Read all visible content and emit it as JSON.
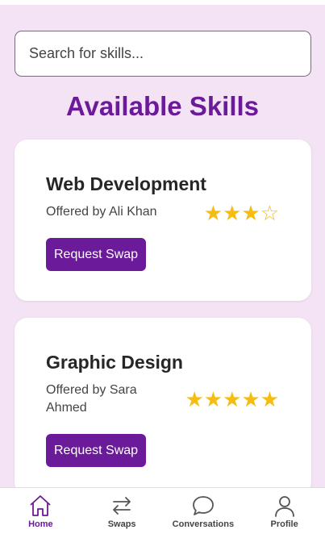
{
  "search": {
    "placeholder": "Search for skills..."
  },
  "page": {
    "title": "Available Skills"
  },
  "skills": [
    {
      "title": "Web Development",
      "offered_by": "Offered by Ali Khan",
      "rating": 3,
      "stars": "★★★☆",
      "button_label": "Request Swap"
    },
    {
      "title": "Graphic Design",
      "offered_by": "Offered by Sara Ahmed",
      "rating": 5,
      "stars": "★★★★★",
      "button_label": "Request Swap"
    }
  ],
  "nav": {
    "items": [
      {
        "label": "Home",
        "icon": "home-icon",
        "active": true
      },
      {
        "label": "Swaps",
        "icon": "swap-arrows-icon",
        "active": false
      },
      {
        "label": "Conversations",
        "icon": "chat-bubble-icon",
        "active": false
      },
      {
        "label": "Profile",
        "icon": "user-icon",
        "active": false
      }
    ]
  },
  "colors": {
    "accent": "#6b1a99",
    "background": "#f3e3f5",
    "star": "#f5bd12"
  }
}
